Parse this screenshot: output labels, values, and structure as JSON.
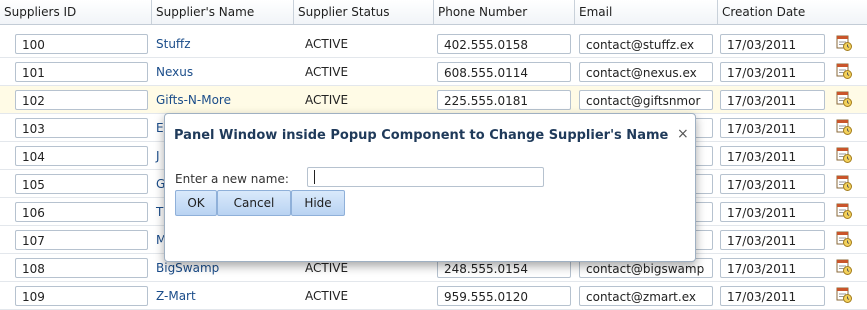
{
  "columns": [
    "Suppliers ID",
    "Supplier's Name",
    "Supplier Status",
    "Phone Number",
    "Email",
    "Creation Date"
  ],
  "rows": [
    {
      "id": "100",
      "name": "Stuffz",
      "status": "ACTIVE",
      "phone": "402.555.0158",
      "email": "contact@stuffz.ex",
      "date": "17/03/2011"
    },
    {
      "id": "101",
      "name": "Nexus",
      "status": "ACTIVE",
      "phone": "608.555.0114",
      "email": "contact@nexus.ex",
      "date": "17/03/2011"
    },
    {
      "id": "102",
      "name": "Gifts-N-More",
      "status": "ACTIVE",
      "phone": "225.555.0181",
      "email": "contact@giftsnmor",
      "date": "17/03/2011"
    },
    {
      "id": "103",
      "name": "E",
      "status": "",
      "phone": "",
      "email": "r",
      "date": "17/03/2011"
    },
    {
      "id": "104",
      "name": "J",
      "status": "",
      "phone": "",
      "email": "r",
      "date": "17/03/2011"
    },
    {
      "id": "105",
      "name": "G",
      "status": "",
      "phone": "",
      "email": "g",
      "date": "17/03/2011"
    },
    {
      "id": "106",
      "name": "T",
      "status": "",
      "phone": "",
      "email": "ol",
      "date": "17/03/2011"
    },
    {
      "id": "107",
      "name": "M",
      "status": "",
      "phone": "",
      "email": "-",
      "date": "17/03/2011"
    },
    {
      "id": "108",
      "name": "BigSwamp",
      "status": "ACTIVE",
      "phone": "248.555.0154",
      "email": "contact@bigswamp",
      "date": "17/03/2011"
    },
    {
      "id": "109",
      "name": "Z-Mart",
      "status": "ACTIVE",
      "phone": "959.555.0120",
      "email": "contact@zmart.ex",
      "date": "17/03/2011"
    }
  ],
  "highlight_row": 2,
  "calendar_icon": "calendar-icon",
  "popup": {
    "title": "Panel Window inside Popup Component to Change Supplier's Name",
    "close_glyph": "×",
    "label": "Enter a new name:",
    "input_value": "",
    "buttons": {
      "ok": "OK",
      "cancel": "Cancel",
      "hide": "Hide"
    }
  },
  "colors": {
    "link": "#1b4d8a",
    "title": "#1f3a5a",
    "button": "#c7dcf5"
  }
}
